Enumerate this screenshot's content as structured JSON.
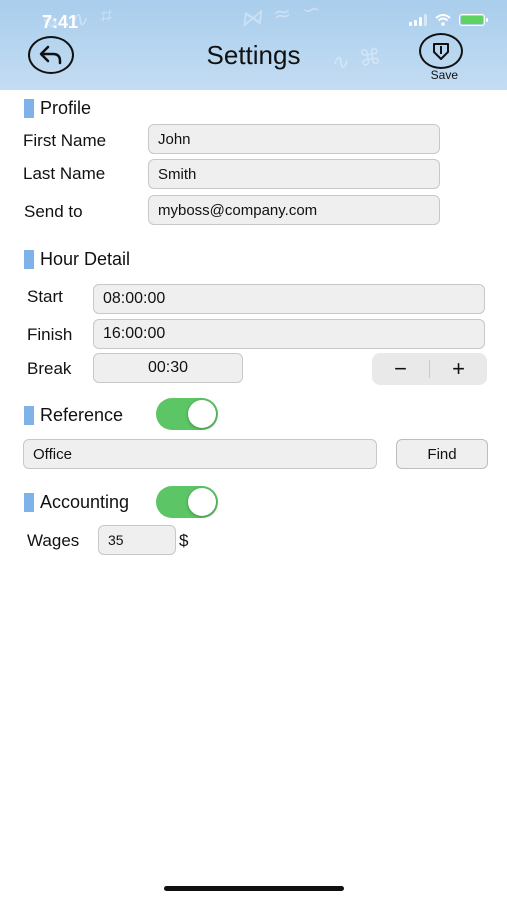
{
  "status_bar": {
    "time": "7:41"
  },
  "header": {
    "title": "Settings",
    "save_label": "Save"
  },
  "profile": {
    "heading": "Profile",
    "first_name_label": "First Name",
    "first_name_value": "John",
    "last_name_label": "Last Name",
    "last_name_value": "Smith",
    "send_to_label": "Send to",
    "send_to_value": "myboss@company.com"
  },
  "hour_detail": {
    "heading": "Hour Detail",
    "start_label": "Start",
    "start_value": "08:00:00",
    "finish_label": "Finish",
    "finish_value": "16:00:00",
    "break_label": "Break",
    "break_value": "00:30",
    "stepper_minus": "−",
    "stepper_plus": "+"
  },
  "reference": {
    "heading": "Reference",
    "enabled": true,
    "value": "Office",
    "find_label": "Find"
  },
  "accounting": {
    "heading": "Accounting",
    "enabled": true,
    "wages_label": "Wages",
    "wages_value": "35",
    "currency": "$"
  },
  "colors": {
    "accent_bar": "#7fb2e8",
    "toggle_on": "#5cc565",
    "header_bg": "#b7d6f0"
  }
}
